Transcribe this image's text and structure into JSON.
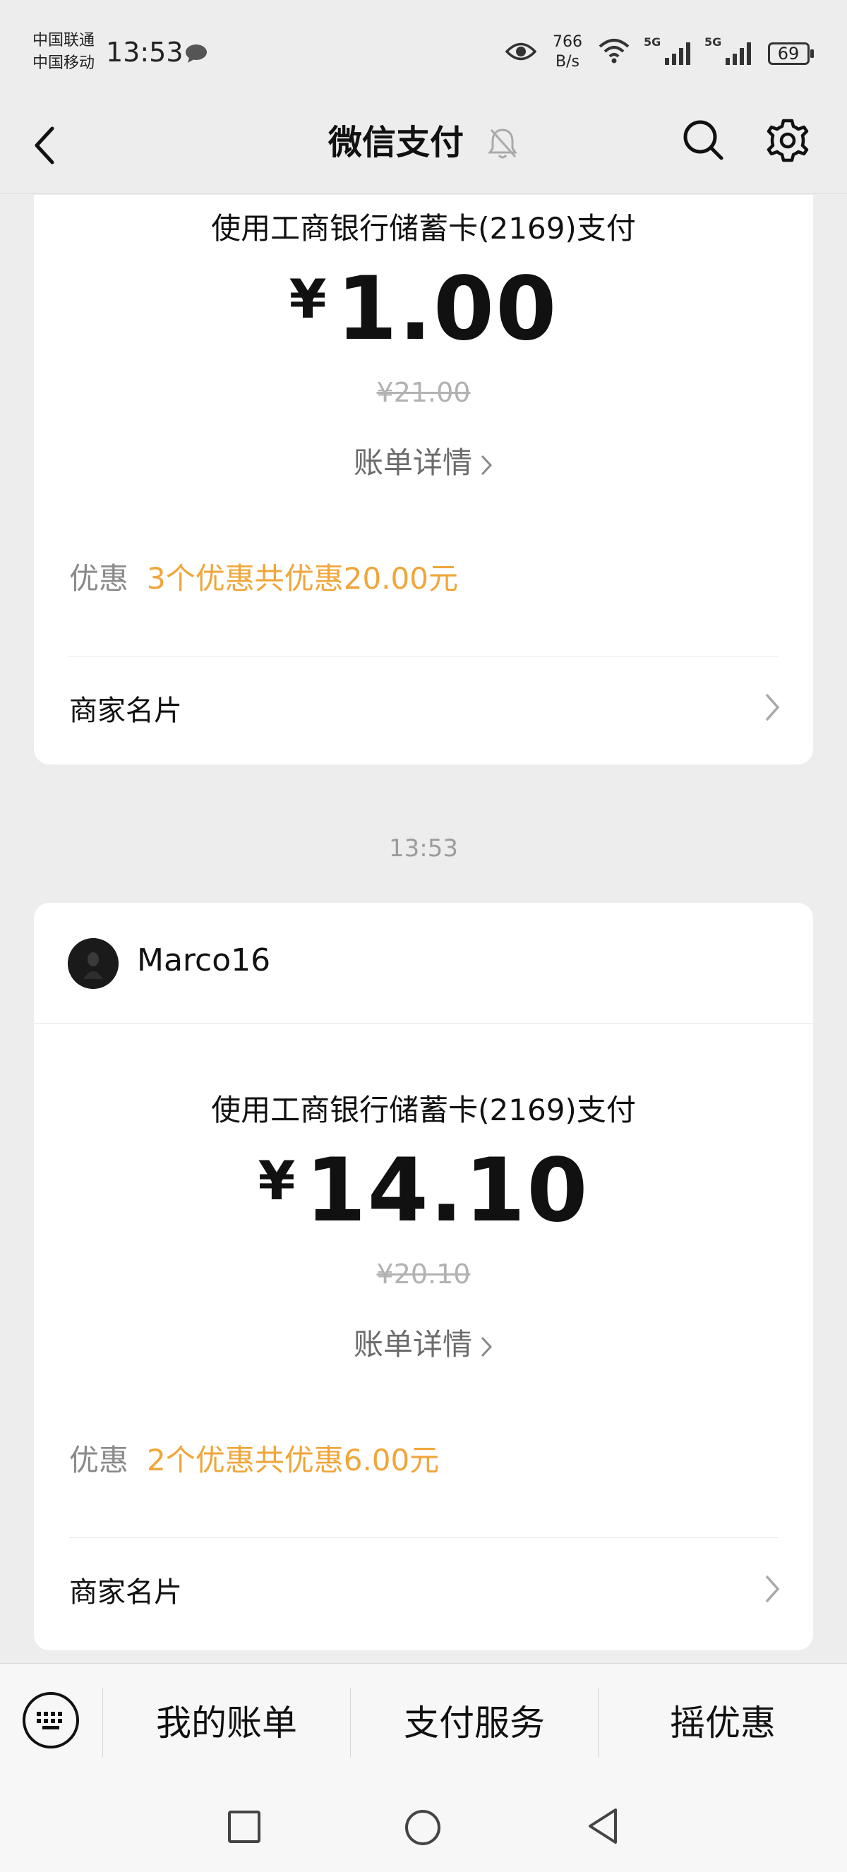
{
  "status_bar": {
    "carrier_1": "中国联通",
    "carrier_2": "中国移动",
    "time": "13:53",
    "net_speed_value": "766",
    "net_speed_unit": "B/s",
    "signal_1_label": "5G",
    "signal_2_label": "5G",
    "battery": "69"
  },
  "header": {
    "title": "微信支付",
    "icons": [
      "back-icon",
      "mute-bell-icon",
      "search-icon",
      "settings-icon"
    ]
  },
  "cards": [
    {
      "pay_method": "使用工商银行储蓄卡(2169)支付",
      "currency": "¥",
      "amount": "1.00",
      "original_amount": "¥21.00",
      "bill_link": "账单详情",
      "discount_label": "优惠",
      "discount_text": "3个优惠共优惠20.00元",
      "merchant_card": "商家名片"
    },
    {
      "merchant_name": "Marco16",
      "pay_method": "使用工商银行储蓄卡(2169)支付",
      "currency": "¥",
      "amount": "14.10",
      "original_amount": "¥20.10",
      "bill_link": "账单详情",
      "discount_label": "优惠",
      "discount_text": "2个优惠共优惠6.00元",
      "merchant_card": "商家名片"
    }
  ],
  "timestamp": "13:53",
  "bottom_menu": {
    "items": [
      "我的账单",
      "支付服务",
      "摇优惠"
    ]
  },
  "colors": {
    "background": "#ededed",
    "card": "#ffffff",
    "discount": "#f0a63a",
    "muted_text": "#8a8a8a"
  }
}
